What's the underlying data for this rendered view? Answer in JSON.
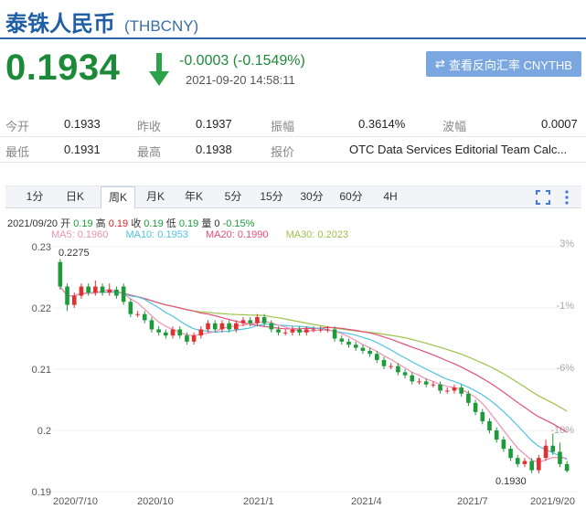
{
  "header": {
    "name": "泰铢人民币",
    "code": "(THBCNY)"
  },
  "quote": {
    "price": "0.1934",
    "change": "-0.0003 (-0.1549%)",
    "time": "2021-09-20 14:58:11",
    "reverse_button": "查看反向汇率 CNYTHB",
    "color_down": "#1d8a3a"
  },
  "stats": {
    "row1": [
      {
        "label": "今开",
        "value": "0.1933"
      },
      {
        "label": "昨收",
        "value": "0.1937"
      },
      {
        "label": "振幅",
        "value": "0.3614%"
      },
      {
        "label": "波幅",
        "value": "0.0007"
      }
    ],
    "row2": [
      {
        "label": "最低",
        "value": "0.1931"
      },
      {
        "label": "最高",
        "value": "0.1938"
      },
      {
        "label": "报价",
        "value": "OTC Data Services Editorial Team Calc..."
      }
    ]
  },
  "tabs": [
    "1分",
    "日K",
    "周K",
    "月K",
    "年K",
    "5分",
    "15分",
    "30分",
    "60分",
    "4H"
  ],
  "active_tab": "周K",
  "ohlc_line": {
    "date": "2021/09/20",
    "open_label": "开",
    "open": "0.19",
    "high_label": "高",
    "high": "0.19",
    "close_label": "收",
    "close": "0.19",
    "low_label": "低",
    "low": "0.19",
    "vol_label": "量",
    "vol": "0",
    "pct": "-0.15%"
  },
  "ma_legend": [
    {
      "text": "MA5: 0.1960",
      "color": "#f08fb0"
    },
    {
      "text": "MA10: 0.1953",
      "color": "#4fc3e0"
    },
    {
      "text": "MA20: 0.1990",
      "color": "#e0507a"
    },
    {
      "text": "MA30: 0.2023",
      "color": "#9cc24a"
    }
  ],
  "chart_data": {
    "type": "candlestick",
    "y_ticks": [
      "0.23",
      "0.22",
      "0.21",
      "0.2",
      "0.19"
    ],
    "pct_ticks": [
      "3%",
      "-1%",
      "-6%",
      "-10%"
    ],
    "x_ticks": [
      "2020/7/10",
      "2020/10",
      "2021/1",
      "2021/4",
      "2021/7",
      "2021/9/20"
    ],
    "annotations": {
      "max": "0.2275",
      "min": "0.1930"
    },
    "ylim": [
      0.19,
      0.23
    ],
    "up_color": "#e03030",
    "down_color": "#1d9a3a",
    "candles": [
      [
        0.2275,
        0.2235,
        0.228,
        0.223
      ],
      [
        0.2235,
        0.2205,
        0.224,
        0.2195
      ],
      [
        0.2205,
        0.222,
        0.2225,
        0.22
      ],
      [
        0.222,
        0.2235,
        0.224,
        0.2215
      ],
      [
        0.2235,
        0.2225,
        0.224,
        0.222
      ],
      [
        0.2225,
        0.2235,
        0.2245,
        0.222
      ],
      [
        0.2235,
        0.2225,
        0.224,
        0.222
      ],
      [
        0.2225,
        0.223,
        0.224,
        0.222
      ],
      [
        0.223,
        0.222,
        0.2235,
        0.2215
      ],
      [
        0.2235,
        0.221,
        0.224,
        0.2205
      ],
      [
        0.221,
        0.219,
        0.2215,
        0.2185
      ],
      [
        0.219,
        0.219,
        0.2195,
        0.2185
      ],
      [
        0.219,
        0.218,
        0.2195,
        0.2175
      ],
      [
        0.218,
        0.2165,
        0.2185,
        0.216
      ],
      [
        0.2165,
        0.216,
        0.217,
        0.2155
      ],
      [
        0.216,
        0.2155,
        0.2165,
        0.215
      ],
      [
        0.2155,
        0.2165,
        0.217,
        0.215
      ],
      [
        0.2165,
        0.2155,
        0.217,
        0.215
      ],
      [
        0.2155,
        0.2145,
        0.216,
        0.214
      ],
      [
        0.2145,
        0.2155,
        0.216,
        0.214
      ],
      [
        0.2155,
        0.2165,
        0.217,
        0.215
      ],
      [
        0.2165,
        0.2175,
        0.218,
        0.216
      ],
      [
        0.2175,
        0.2165,
        0.218,
        0.216
      ],
      [
        0.2165,
        0.2175,
        0.218,
        0.216
      ],
      [
        0.2175,
        0.2165,
        0.218,
        0.216
      ],
      [
        0.2165,
        0.2175,
        0.218,
        0.216
      ],
      [
        0.2175,
        0.218,
        0.2185,
        0.217
      ],
      [
        0.218,
        0.2175,
        0.2185,
        0.217
      ],
      [
        0.2175,
        0.2185,
        0.219,
        0.217
      ],
      [
        0.2185,
        0.2175,
        0.219,
        0.217
      ],
      [
        0.2175,
        0.2165,
        0.218,
        0.216
      ],
      [
        0.2165,
        0.216,
        0.217,
        0.2155
      ],
      [
        0.216,
        0.216,
        0.2165,
        0.2155
      ],
      [
        0.216,
        0.2165,
        0.217,
        0.2155
      ],
      [
        0.2165,
        0.216,
        0.217,
        0.2155
      ],
      [
        0.216,
        0.2165,
        0.217,
        0.2155
      ],
      [
        0.2165,
        0.2165,
        0.217,
        0.216
      ],
      [
        0.2165,
        0.2165,
        0.217,
        0.216
      ],
      [
        0.2165,
        0.2165,
        0.217,
        0.216
      ],
      [
        0.2165,
        0.215,
        0.217,
        0.2145
      ],
      [
        0.215,
        0.2145,
        0.2155,
        0.214
      ],
      [
        0.2145,
        0.214,
        0.215,
        0.2135
      ],
      [
        0.214,
        0.2135,
        0.2145,
        0.213
      ],
      [
        0.2135,
        0.213,
        0.214,
        0.2125
      ],
      [
        0.213,
        0.2125,
        0.2135,
        0.212
      ],
      [
        0.2125,
        0.2115,
        0.213,
        0.211
      ],
      [
        0.2115,
        0.2105,
        0.212,
        0.21
      ],
      [
        0.2105,
        0.2105,
        0.211,
        0.21
      ],
      [
        0.2105,
        0.2095,
        0.211,
        0.209
      ],
      [
        0.2095,
        0.209,
        0.21,
        0.2085
      ],
      [
        0.209,
        0.208,
        0.2095,
        0.2075
      ],
      [
        0.208,
        0.208,
        0.2085,
        0.2075
      ],
      [
        0.208,
        0.2075,
        0.2085,
        0.207
      ],
      [
        0.2075,
        0.2075,
        0.208,
        0.207
      ],
      [
        0.2075,
        0.2065,
        0.208,
        0.206
      ],
      [
        0.2065,
        0.2065,
        0.207,
        0.206
      ],
      [
        0.2065,
        0.207,
        0.2075,
        0.206
      ],
      [
        0.207,
        0.206,
        0.2075,
        0.2055
      ],
      [
        0.206,
        0.2045,
        0.2065,
        0.204
      ],
      [
        0.2045,
        0.203,
        0.205,
        0.2025
      ],
      [
        0.203,
        0.2015,
        0.2035,
        0.201
      ],
      [
        0.2015,
        0.2,
        0.202,
        0.1995
      ],
      [
        0.2,
        0.1985,
        0.2005,
        0.198
      ],
      [
        0.1985,
        0.197,
        0.199,
        0.1965
      ],
      [
        0.197,
        0.1955,
        0.1975,
        0.195
      ],
      [
        0.1955,
        0.1945,
        0.196,
        0.194
      ],
      [
        0.1945,
        0.195,
        0.1955,
        0.194
      ],
      [
        0.195,
        0.1935,
        0.1955,
        0.193
      ],
      [
        0.1935,
        0.1955,
        0.196,
        0.193
      ],
      [
        0.1955,
        0.1975,
        0.1985,
        0.195
      ],
      [
        0.1975,
        0.1965,
        0.1995,
        0.196
      ],
      [
        0.1965,
        0.1945,
        0.198,
        0.194
      ],
      [
        0.1945,
        0.1934,
        0.195,
        0.1931
      ]
    ]
  }
}
